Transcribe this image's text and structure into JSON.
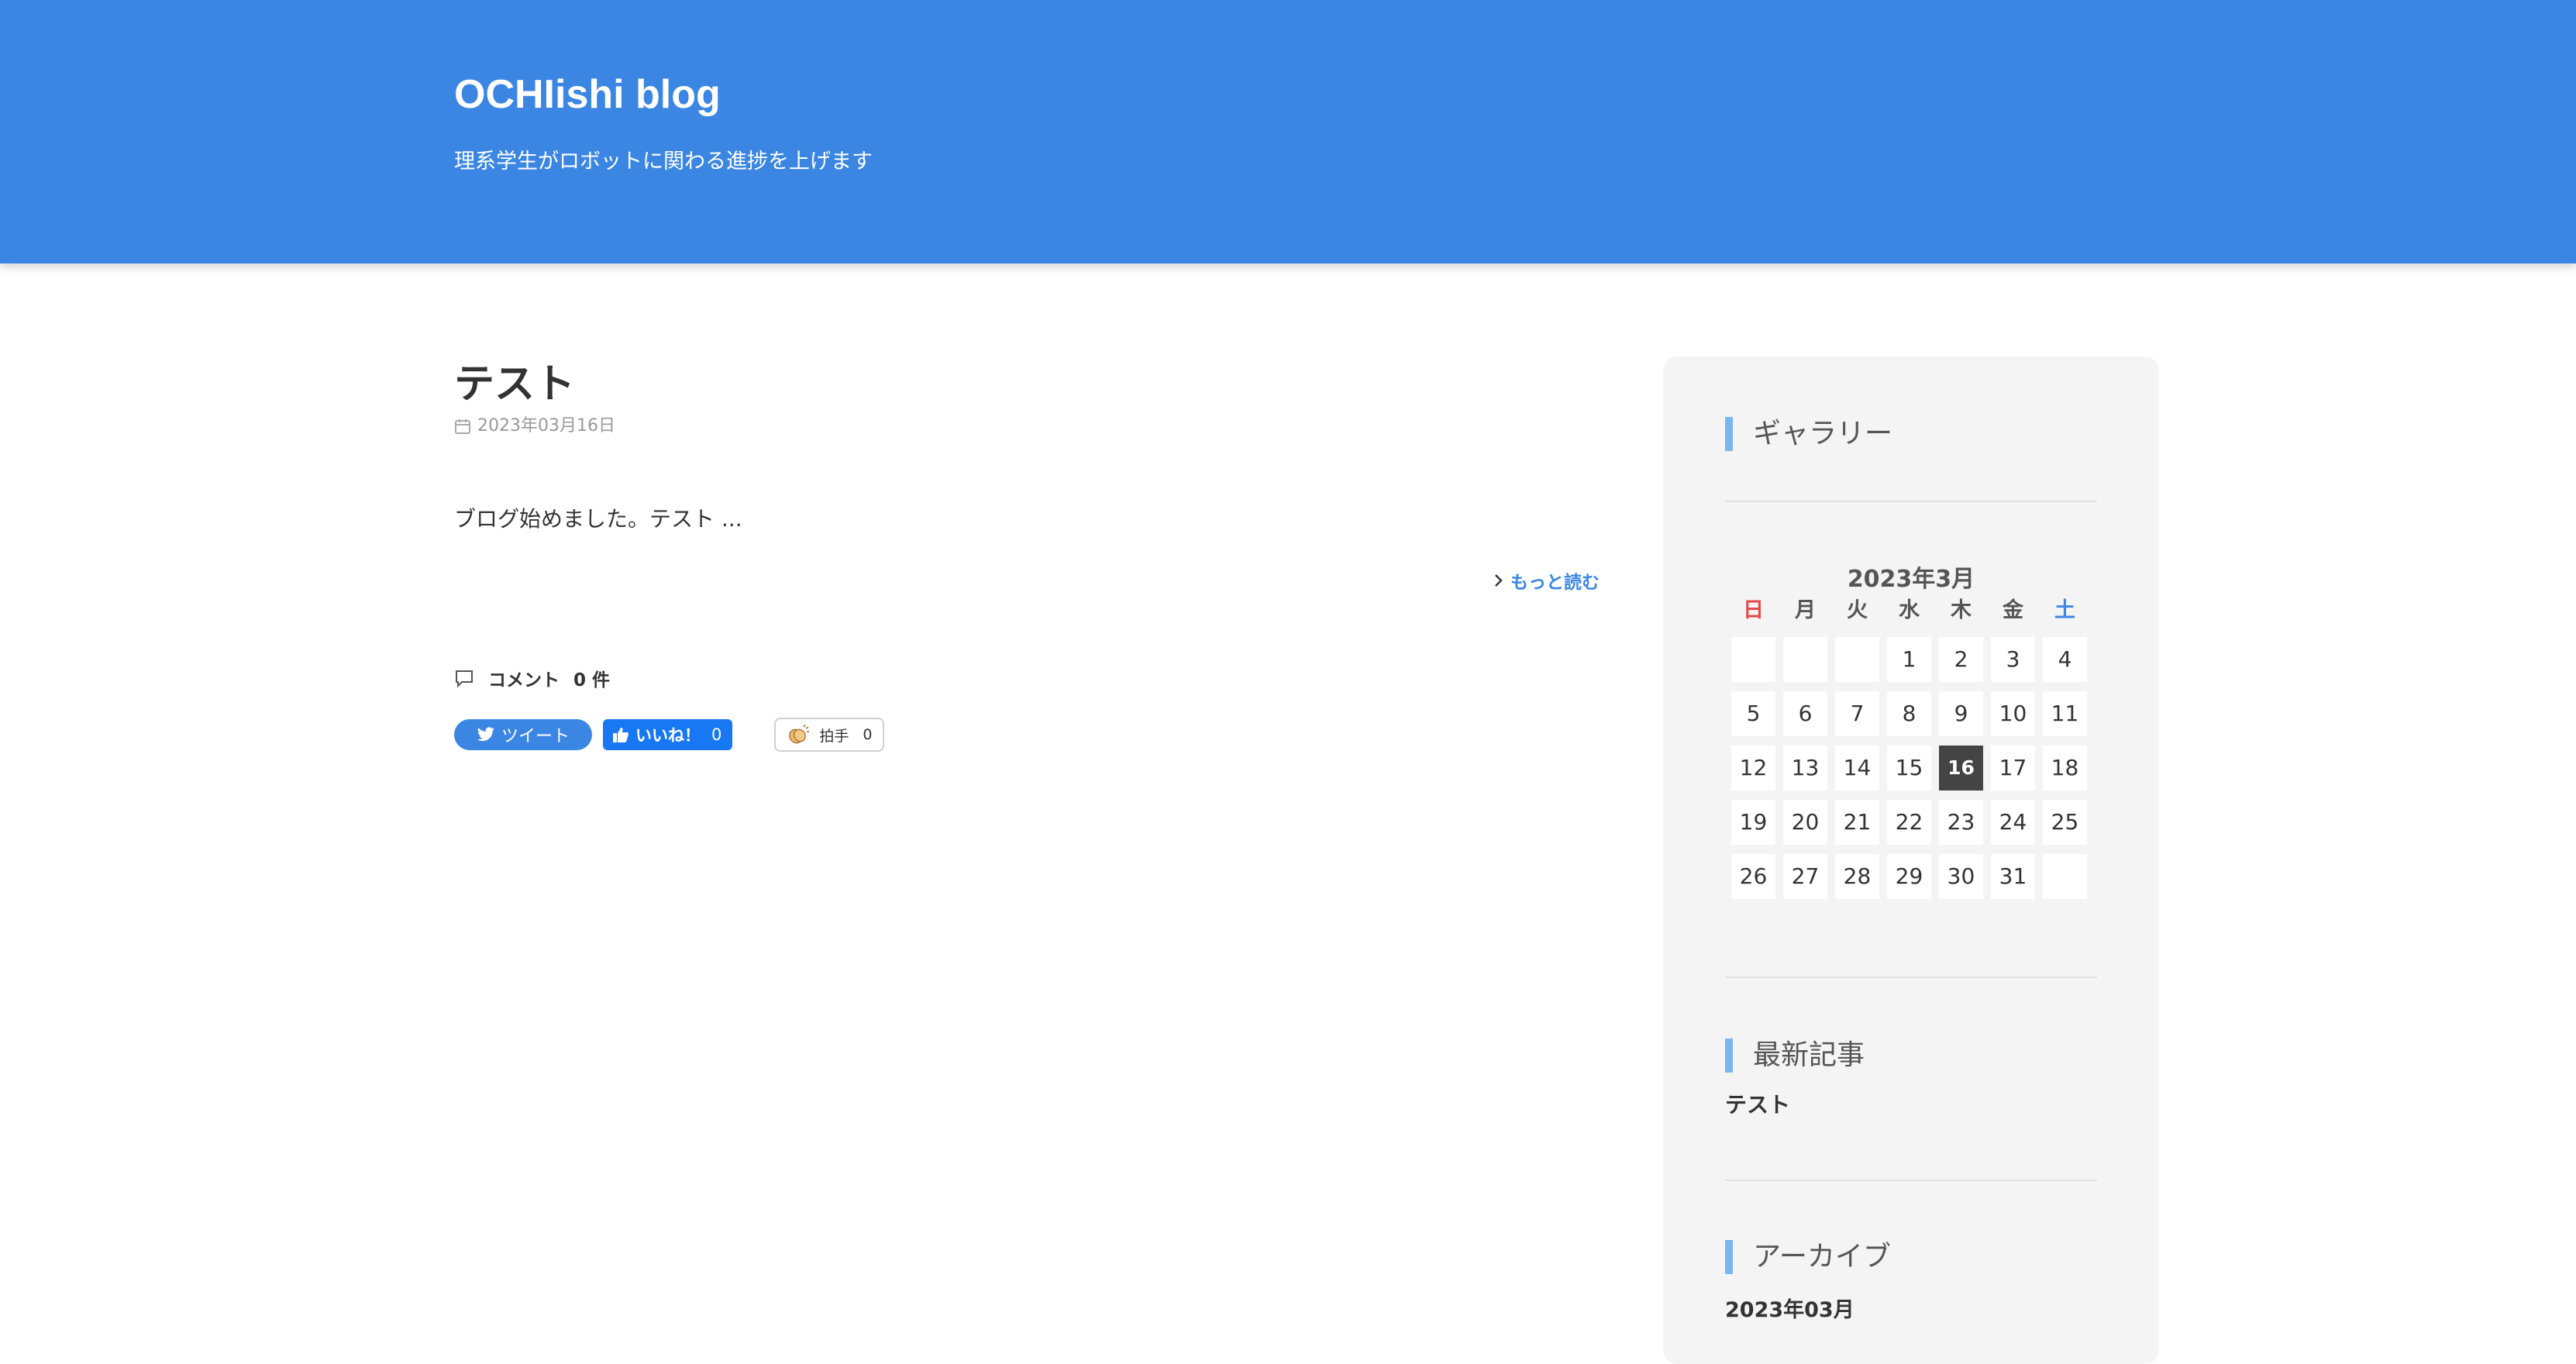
{
  "header": {
    "title": "OCHIishi blog",
    "description": "理系学生がロボットに関わる進捗を上げます"
  },
  "post": {
    "title": "テスト",
    "date": "2023年03月16日",
    "excerpt": "ブログ始めました。テスト ...",
    "read_more": "もっと読む",
    "comments_label": "コメント",
    "comments_count": "0 件"
  },
  "share": {
    "tweet": "ツイート",
    "like": "いいね！",
    "like_count": "0",
    "clap": "拍手",
    "clap_count": "0"
  },
  "sidebar": {
    "gallery_title": "ギャラリー",
    "calendar": {
      "caption": "2023年3月",
      "weekdays": [
        "日",
        "月",
        "火",
        "水",
        "木",
        "金",
        "土"
      ],
      "days": [
        "",
        "",
        "",
        "1",
        "2",
        "3",
        "4",
        "5",
        "6",
        "7",
        "8",
        "9",
        "10",
        "11",
        "12",
        "13",
        "14",
        "15",
        "16",
        "17",
        "18",
        "19",
        "20",
        "21",
        "22",
        "23",
        "24",
        "25",
        "26",
        "27",
        "28",
        "29",
        "30",
        "31",
        ""
      ],
      "today": "16"
    },
    "recent_title": "最新記事",
    "recent_items": [
      "テスト"
    ],
    "archive_title": "アーカイブ",
    "archive_items": [
      "2023年03月"
    ]
  },
  "colors": {
    "header_bg": "#3b86e3",
    "accent": "#3b86e3",
    "sunday": "#e24b4b",
    "saturday": "#3b86e3",
    "today_bg": "#444444"
  }
}
